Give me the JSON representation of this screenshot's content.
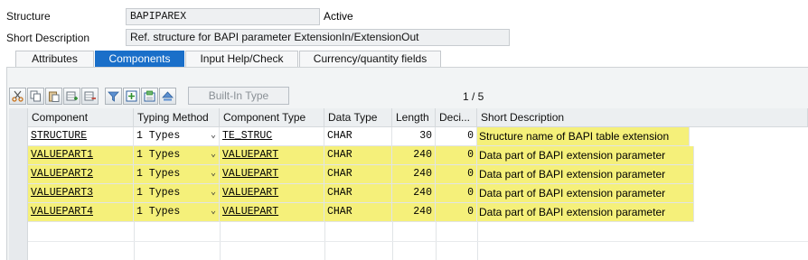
{
  "header": {
    "structure_label": "Structure",
    "structure_value": "BAPIPAREX",
    "status": "Active",
    "short_desc_label": "Short Description",
    "short_desc_value": "Ref. structure for BAPI parameter ExtensionIn/ExtensionOut"
  },
  "tabs": [
    {
      "label": "Attributes",
      "active": false
    },
    {
      "label": "Components",
      "active": true
    },
    {
      "label": "Input Help/Check",
      "active": false
    },
    {
      "label": "Currency/quantity fields",
      "active": false
    }
  ],
  "toolbar": {
    "icons": [
      "cut-icon",
      "copy-icon",
      "paste-icon",
      "insert-row-icon",
      "delete-row-icon",
      "filter-icon",
      "new-field-icon",
      "build-icon",
      "navigate-up-icon"
    ],
    "builtin_type_label": "Built-In Type",
    "pager": "1 / 5"
  },
  "table": {
    "columns": [
      "Component",
      "Typing Method",
      "Component Type",
      "Data Type",
      "Length",
      "Deci...",
      "Short Description"
    ],
    "rows": [
      {
        "component": "STRUCTURE",
        "typing": "1 Types",
        "ctype": "TE_STRUC",
        "dtype": "CHAR",
        "length": "30",
        "deci": "0",
        "desc": "Structure name of  BAPI table extension"
      },
      {
        "component": "VALUEPART1",
        "typing": "1 Types",
        "ctype": "VALUEPART",
        "dtype": "CHAR",
        "length": "240",
        "deci": "0",
        "desc": "Data part of BAPI extension parameter"
      },
      {
        "component": "VALUEPART2",
        "typing": "1 Types",
        "ctype": "VALUEPART",
        "dtype": "CHAR",
        "length": "240",
        "deci": "0",
        "desc": "Data part of BAPI extension parameter"
      },
      {
        "component": "VALUEPART3",
        "typing": "1 Types",
        "ctype": "VALUEPART",
        "dtype": "CHAR",
        "length": "240",
        "deci": "0",
        "desc": "Data part of BAPI extension parameter"
      },
      {
        "component": "VALUEPART4",
        "typing": "1 Types",
        "ctype": "VALUEPART",
        "dtype": "CHAR",
        "length": "240",
        "deci": "0",
        "desc": "Data part of BAPI extension parameter"
      }
    ]
  },
  "colors": {
    "active_tab": "#1a6fc9",
    "highlight": "#f5f07a"
  }
}
